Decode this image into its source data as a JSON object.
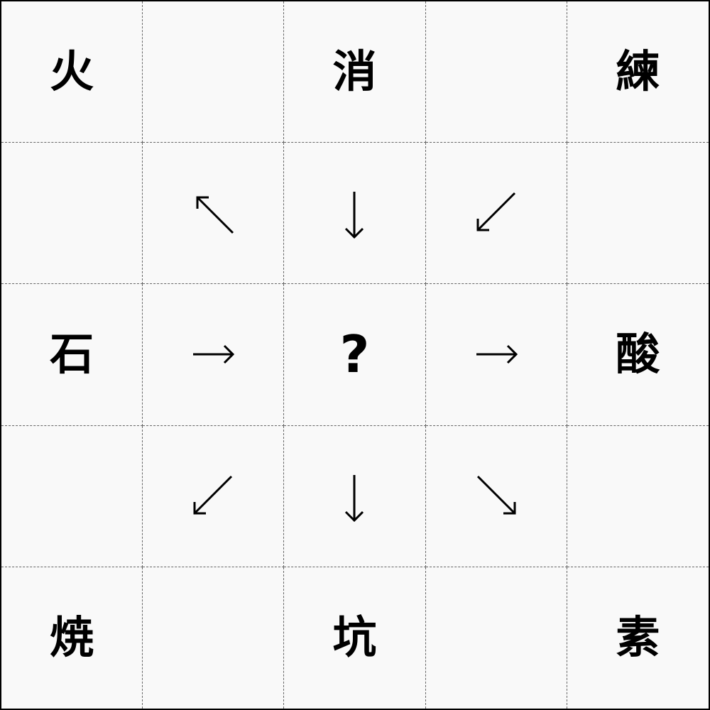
{
  "puzzle": {
    "top_left": "火",
    "top_center": "消",
    "top_right": "練",
    "middle_left": "石",
    "center": "?",
    "middle_right": "酸",
    "bottom_left": "焼",
    "bottom_center": "坑",
    "bottom_right": "素"
  },
  "arrows": {
    "r1c1": "up-left",
    "r1c2": "down",
    "r1c3": "down-left",
    "r2c1": "right",
    "r2c3": "right",
    "r3c1": "down-left",
    "r3c2": "down",
    "r3c3": "down-right"
  },
  "colors": {
    "ink": "#000000",
    "grid": "#666666",
    "cell_bg": "#f9f9f9"
  }
}
